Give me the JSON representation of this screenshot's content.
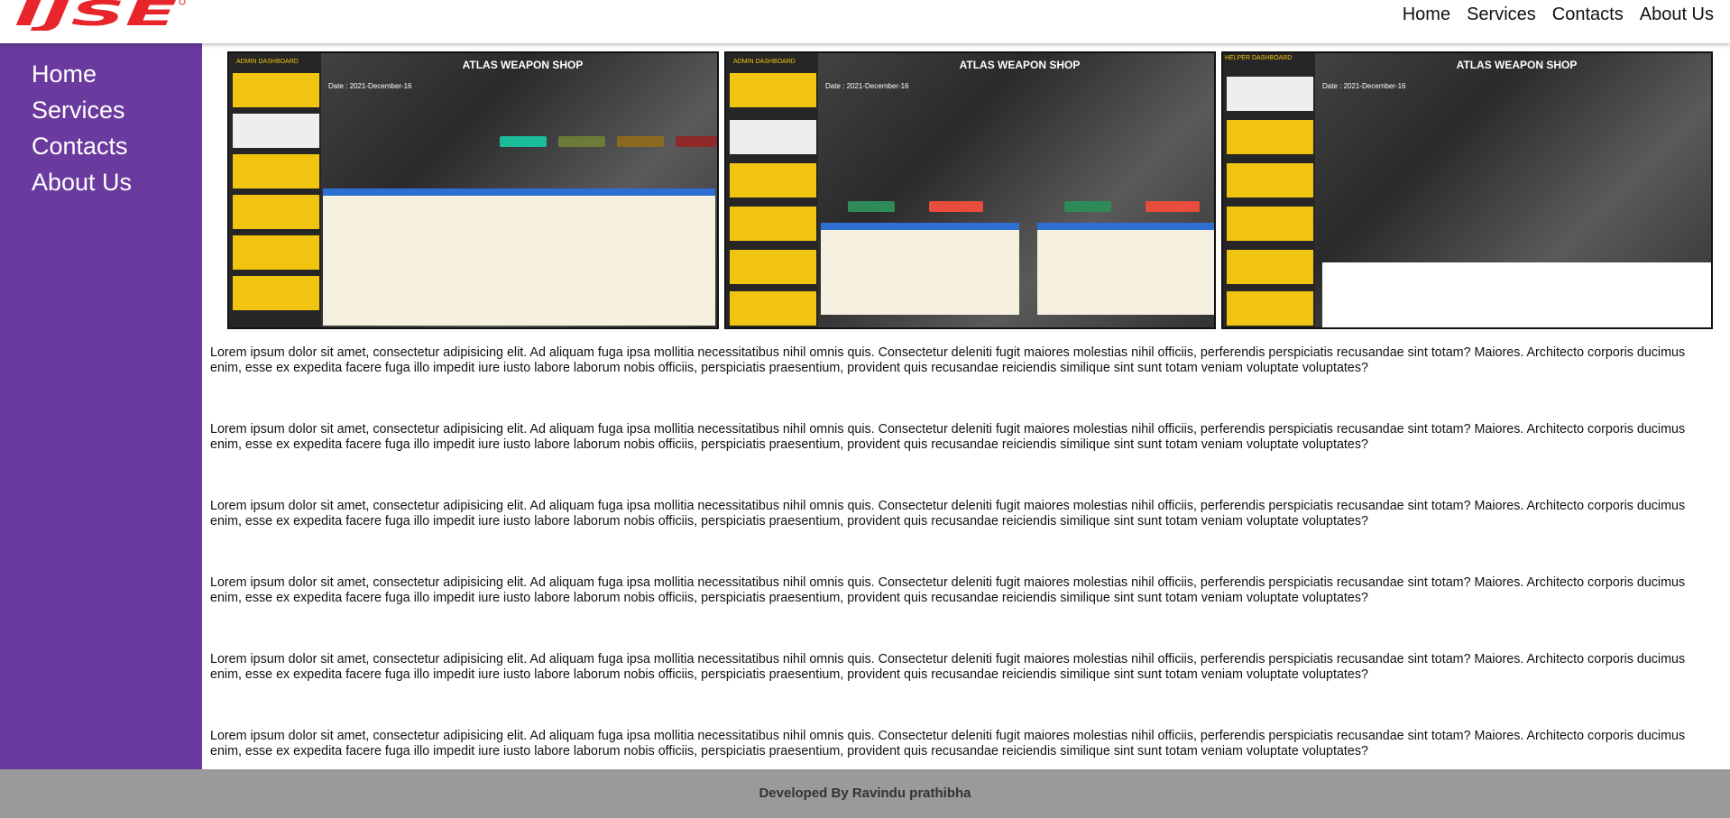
{
  "brand": {
    "logo_text": "IJSE",
    "logo_color": "#e8252b"
  },
  "top_nav": [
    "Home",
    "Services",
    "Contacts",
    "About Us"
  ],
  "side_nav": [
    "Home",
    "Services",
    "Contacts",
    "About Us"
  ],
  "colors": {
    "sidebar": "#6a3a9e",
    "footer": "#9a9a9a",
    "accent_yellow": "#f1c40f"
  },
  "gallery": [
    {
      "title": "ATLAS WEAPON SHOP",
      "panel": "ADMIN DASHBOARD",
      "date": "Date : 2021-December-16"
    },
    {
      "title": "ATLAS WEAPON SHOP",
      "panel": "ADMIN DASHBOARD",
      "date": "Date : 2021-December-16"
    },
    {
      "title": "ATLAS WEAPON SHOP",
      "panel": "HELPER DASHBOARD",
      "date": "Date : 2021-December-16"
    }
  ],
  "paragraphs": [
    "Lorem ipsum dolor sit amet, consectetur adipisicing elit. Ad aliquam fuga ipsa mollitia necessitatibus nihil omnis quis. Consectetur deleniti fugit maiores molestias nihil officiis, perferendis perspiciatis recusandae sint totam? Maiores. Architecto corporis ducimus enim, esse ex expedita facere fuga illo impedit iure iusto labore laborum nobis officiis, perspiciatis praesentium, provident quis recusandae reiciendis similique sint sunt totam veniam voluptate voluptates?",
    "Lorem ipsum dolor sit amet, consectetur adipisicing elit. Ad aliquam fuga ipsa mollitia necessitatibus nihil omnis quis. Consectetur deleniti fugit maiores molestias nihil officiis, perferendis perspiciatis recusandae sint totam? Maiores. Architecto corporis ducimus enim, esse ex expedita facere fuga illo impedit iure iusto labore laborum nobis officiis, perspiciatis praesentium, provident quis recusandae reiciendis similique sint sunt totam veniam voluptate voluptates?",
    "Lorem ipsum dolor sit amet, consectetur adipisicing elit. Ad aliquam fuga ipsa mollitia necessitatibus nihil omnis quis. Consectetur deleniti fugit maiores molestias nihil officiis, perferendis perspiciatis recusandae sint totam? Maiores. Architecto corporis ducimus enim, esse ex expedita facere fuga illo impedit iure iusto labore laborum nobis officiis, perspiciatis praesentium, provident quis recusandae reiciendis similique sint sunt totam veniam voluptate voluptates?",
    "Lorem ipsum dolor sit amet, consectetur adipisicing elit. Ad aliquam fuga ipsa mollitia necessitatibus nihil omnis quis. Consectetur deleniti fugit maiores molestias nihil officiis, perferendis perspiciatis recusandae sint totam? Maiores. Architecto corporis ducimus enim, esse ex expedita facere fuga illo impedit iure iusto labore laborum nobis officiis, perspiciatis praesentium, provident quis recusandae reiciendis similique sint sunt totam veniam voluptate voluptates?",
    "Lorem ipsum dolor sit amet, consectetur adipisicing elit. Ad aliquam fuga ipsa mollitia necessitatibus nihil omnis quis. Consectetur deleniti fugit maiores molestias nihil officiis, perferendis perspiciatis recusandae sint totam? Maiores. Architecto corporis ducimus enim, esse ex expedita facere fuga illo impedit iure iusto labore laborum nobis officiis, perspiciatis praesentium, provident quis recusandae reiciendis similique sint sunt totam veniam voluptate voluptates?",
    "Lorem ipsum dolor sit amet, consectetur adipisicing elit. Ad aliquam fuga ipsa mollitia necessitatibus nihil omnis quis. Consectetur deleniti fugit maiores molestias nihil officiis, perferendis perspiciatis recusandae sint totam? Maiores. Architecto corporis ducimus enim, esse ex expedita facere fuga illo impedit iure iusto labore laborum nobis officiis, perspiciatis praesentium, provident quis recusandae reiciendis similique sint sunt totam veniam voluptate voluptates?"
  ],
  "footer": {
    "text": "Developed By Ravindu prathibha"
  }
}
